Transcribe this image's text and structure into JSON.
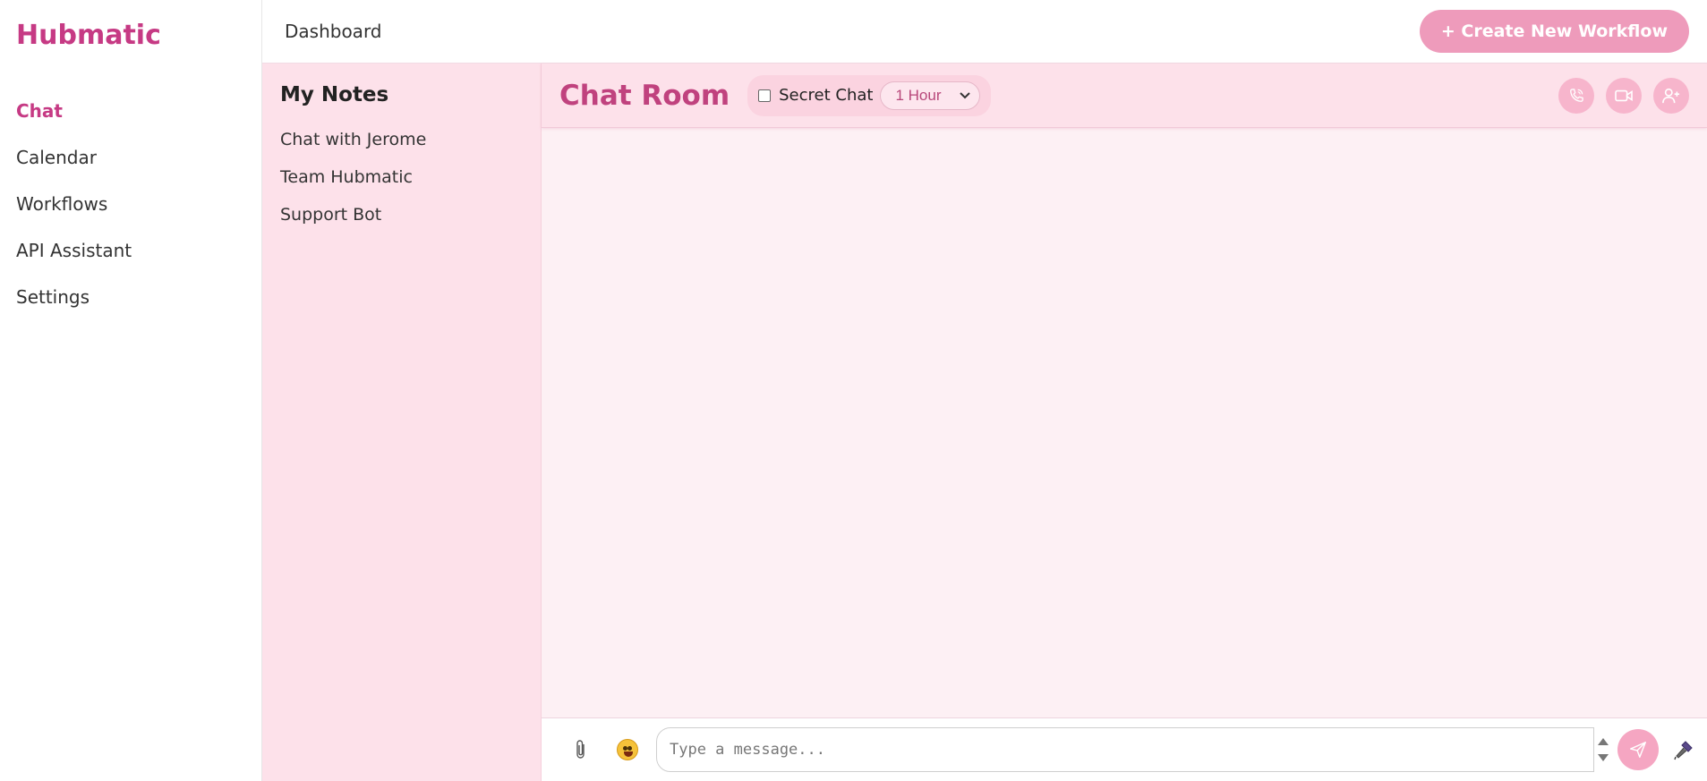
{
  "sidebar": {
    "brand": "Hubmatic",
    "items": [
      {
        "label": "Chat"
      },
      {
        "label": "Calendar"
      },
      {
        "label": "Workflows"
      },
      {
        "label": "API Assistant"
      },
      {
        "label": "Settings"
      }
    ],
    "active": "Chat"
  },
  "topbar": {
    "title": "Dashboard",
    "create_label": "+ Create New Workflow"
  },
  "notes": {
    "title": "My Notes",
    "items": [
      {
        "label": "Chat with Jerome"
      },
      {
        "label": "Team Hubmatic"
      },
      {
        "label": "Support Bot"
      }
    ]
  },
  "chat": {
    "title": "Chat Room",
    "secret_label": "Secret Chat",
    "secret_checked": false,
    "timer_value": "1 Hour",
    "actions": [
      "phone-icon",
      "video-icon",
      "add-user-icon"
    ]
  },
  "composer": {
    "placeholder": "Type a message...",
    "icons": [
      "paperclip-icon",
      "emoji-icon",
      "send-icon",
      "microphone-icon"
    ]
  },
  "colors": {
    "brand": "#c63a84",
    "accent": "#ee9bbb",
    "panel": "#fde1ea"
  }
}
